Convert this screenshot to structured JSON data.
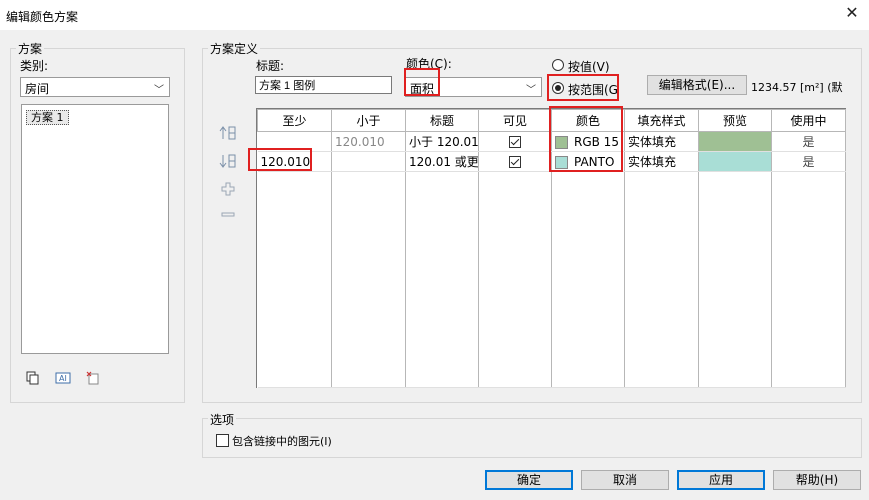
{
  "window": {
    "title": "编辑颜色方案",
    "close_glyph": "✕"
  },
  "scheme_group": {
    "label": "方案",
    "category_label": "类别:",
    "category_value": "房间",
    "schemes": [
      "方案 1"
    ],
    "tool_icons": [
      "duplicate-icon",
      "rename-icon",
      "delete-icon"
    ]
  },
  "definition_group": {
    "label": "方案定义",
    "title_label": "标题:",
    "title_value": "方案 1 图例",
    "color_label": "颜色(C):",
    "color_value": "面积",
    "by_value_label": "按值(V)",
    "by_range_label": "按范围(G",
    "edit_format_label": "编辑格式(E)...",
    "format_example": "1234.57 [m²] (默"
  },
  "row_tools": [
    "insert-above-icon",
    "insert-below-icon",
    "add-value-icon",
    "remove-value-icon"
  ],
  "table": {
    "headers": [
      "至少",
      "小于",
      "标题",
      "可见",
      "颜色",
      "填充样式",
      "预览",
      "使用中"
    ],
    "rows": [
      {
        "at_least": "",
        "less_than": "120.010",
        "caption": "小于 120.01",
        "visible": true,
        "color_text": "RGB 15",
        "color": "#9fc094",
        "fill": "实体填充",
        "preview": "#9fc094",
        "in_use": "是"
      },
      {
        "at_least": "120.010",
        "less_than": "",
        "caption": "120.01 或更",
        "visible": true,
        "color_text": "PANTO",
        "color": "#a9ded6",
        "fill": "实体填充",
        "preview": "#a9ded6",
        "in_use": "是"
      }
    ]
  },
  "options_group": {
    "label": "选项",
    "include_links_label": "包含链接中的图元(I)",
    "include_links_checked": false
  },
  "buttons": {
    "ok": "确定",
    "cancel": "取消",
    "apply": "应用",
    "help": "帮助(H)"
  }
}
